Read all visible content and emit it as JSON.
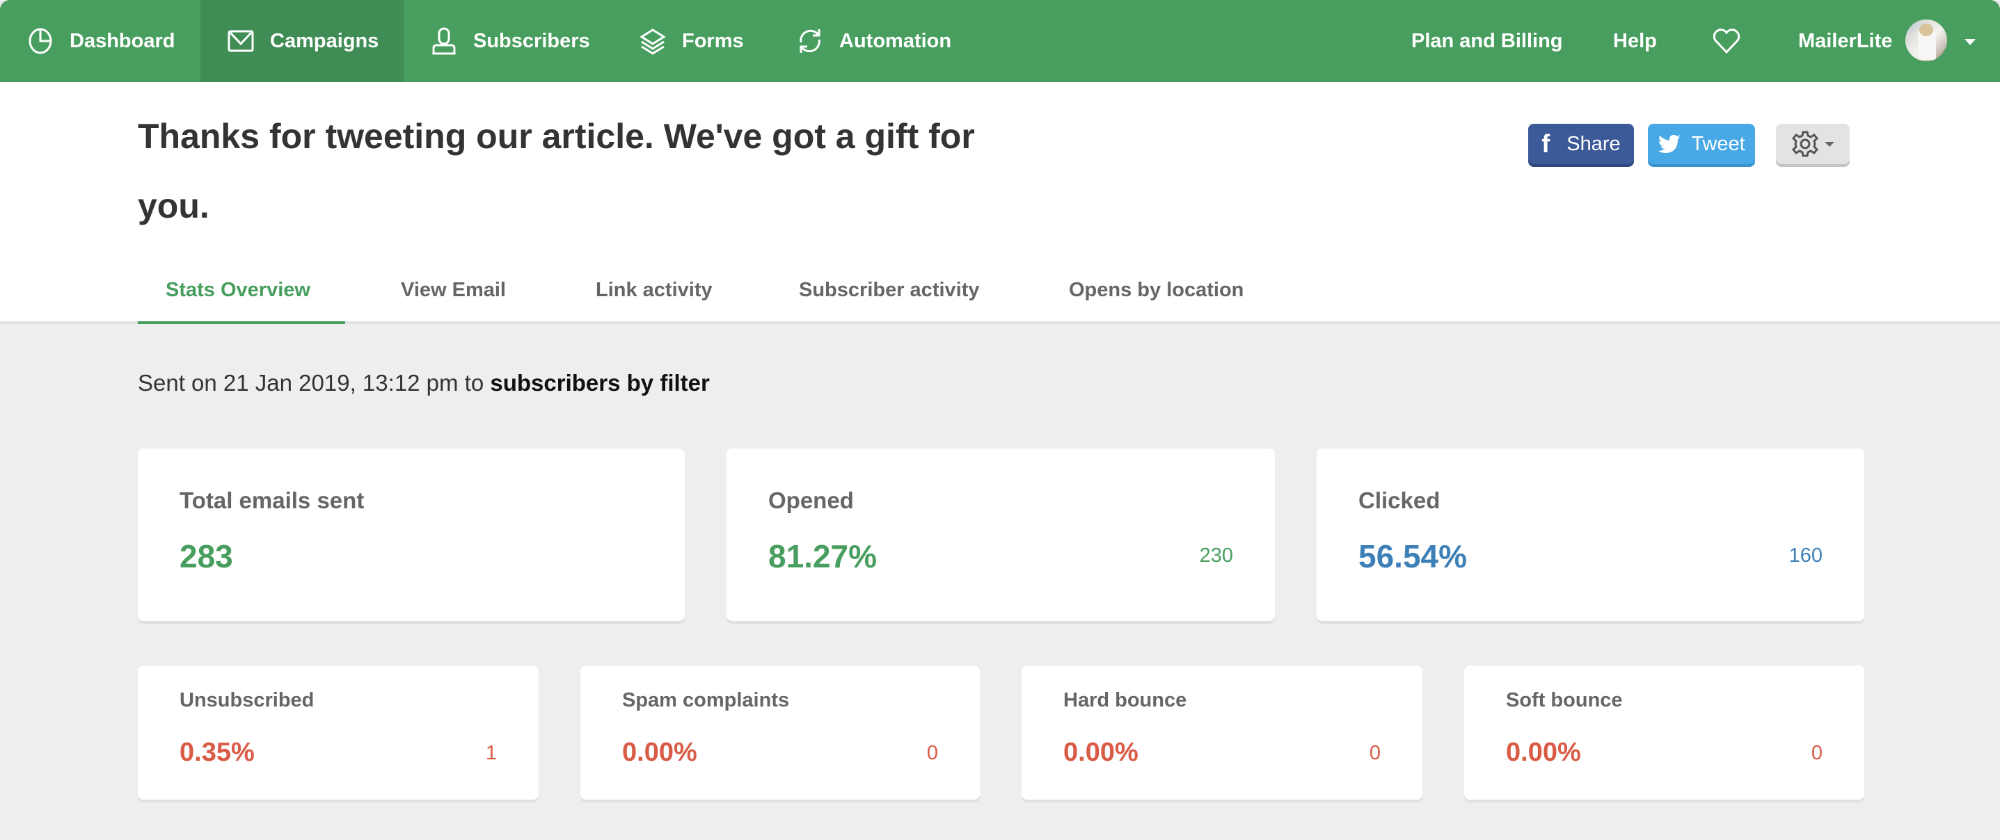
{
  "nav": {
    "items": [
      {
        "label": "Dashboard",
        "icon": "pie-chart-icon",
        "active": false
      },
      {
        "label": "Campaigns",
        "icon": "envelope-icon",
        "active": true
      },
      {
        "label": "Subscribers",
        "icon": "user-icon",
        "active": false
      },
      {
        "label": "Forms",
        "icon": "layers-icon",
        "active": false
      },
      {
        "label": "Automation",
        "icon": "refresh-icon",
        "active": false
      }
    ],
    "plan_billing": "Plan and Billing",
    "help": "Help",
    "favorites_icon": "heart-icon",
    "account_name": "MailerLite",
    "account_caret_icon": "caret-down-icon"
  },
  "header": {
    "title": "Thanks for tweeting our article. We've got a gift for you.",
    "share_button": "Share",
    "tweet_button": "Tweet",
    "settings_icon": "gear-icon"
  },
  "tabs": [
    {
      "label": "Stats Overview",
      "active": true
    },
    {
      "label": "View Email",
      "active": false
    },
    {
      "label": "Link activity",
      "active": false
    },
    {
      "label": "Subscriber activity",
      "active": false
    },
    {
      "label": "Opens by location",
      "active": false
    }
  ],
  "sent_info": {
    "prefix": "Sent on 21 Jan 2019, 13:12 pm to ",
    "recipients": "subscribers by filter"
  },
  "stats": {
    "primary": [
      {
        "label": "Total emails sent",
        "value": "283",
        "count": "",
        "color": "#489e5e"
      },
      {
        "label": "Opened",
        "value": "81.27%",
        "count": "230",
        "color": "#489e5e"
      },
      {
        "label": "Clicked",
        "value": "56.54%",
        "count": "160",
        "color": "#3d80b8"
      }
    ],
    "secondary": [
      {
        "label": "Unsubscribed",
        "value": "0.35%",
        "count": "1",
        "color": "#d95a45"
      },
      {
        "label": "Spam complaints",
        "value": "0.00%",
        "count": "0",
        "color": "#d95a45"
      },
      {
        "label": "Hard bounce",
        "value": "0.00%",
        "count": "0",
        "color": "#d95a45"
      },
      {
        "label": "Soft bounce",
        "value": "0.00%",
        "count": "0",
        "color": "#d95a45"
      }
    ]
  }
}
